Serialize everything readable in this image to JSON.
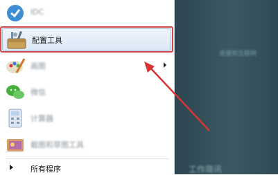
{
  "menu": {
    "items": [
      {
        "label": "IDC",
        "icon": "app-icon"
      },
      {
        "label": "配置工具",
        "icon": "toolbox-icon"
      },
      {
        "label": "画图",
        "icon": "paint-icon"
      },
      {
        "label": "微信",
        "icon": "wechat-icon"
      },
      {
        "label": "计算器",
        "icon": "calculator-icon"
      },
      {
        "label": "截图和草图工具",
        "icon": "snipping-icon"
      }
    ],
    "all_programs": "所有程序"
  },
  "desktop": {
    "text1": "连接到互联网",
    "text2": "工作简讯"
  },
  "colors": {
    "highlight_border": "#d24a4a",
    "annotation_arrow": "#d93434"
  }
}
